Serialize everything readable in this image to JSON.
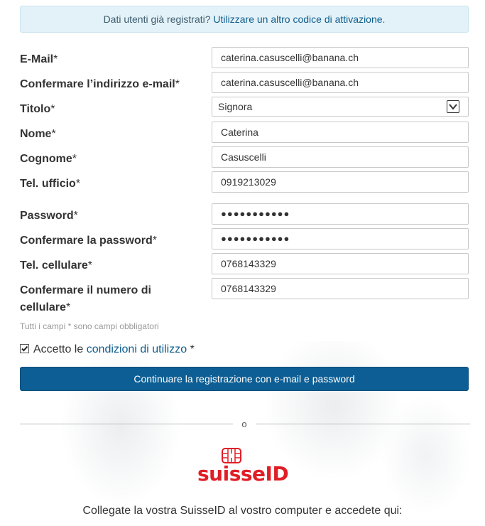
{
  "info": {
    "text": "Dati utenti già registrati?",
    "link": "Utilizzare un altro codice di attivazione",
    "suffix": "."
  },
  "form": {
    "email": {
      "label": "E-Mail",
      "value": "caterina.casuscelli@banana.ch"
    },
    "email_confirm": {
      "label": "Confermare l’indirizzo e-mail",
      "value": "caterina.casuscelli@banana.ch"
    },
    "title": {
      "label": "Titolo",
      "value": "Signora"
    },
    "first_name": {
      "label": "Nome",
      "value": "Caterina"
    },
    "last_name": {
      "label": "Cognome",
      "value": "Casuscelli"
    },
    "office_phone": {
      "label": "Tel. ufficio",
      "value": "0919213029"
    },
    "password": {
      "label": "Password",
      "value": "●●●●●●●●●●●"
    },
    "password_confirm": {
      "label": "Confermare la password",
      "value": "●●●●●●●●●●●"
    },
    "mobile": {
      "label": "Tel. cellulare",
      "value": "0768143329"
    },
    "mobile_confirm": {
      "label": "Confermare il numero di cellulare",
      "value": "0768143329"
    },
    "required_marker": "*",
    "required_note": "Tutti i campi * sono campi obbligatori",
    "terms_prefix": "Accetto le",
    "terms_link": "condizioni di utilizzo",
    "terms_suffix": " *",
    "terms_checked": true,
    "submit_label": "Continuare la registrazione con e-mail e password"
  },
  "alt": {
    "or_label": "o",
    "logo_text": "suisseID",
    "connect_text": "Collegate la vostra SuisseID al vostro computer e accedete qui:"
  },
  "colors": {
    "primary": "#0d5e94",
    "link": "#0e5c8c",
    "brand_red": "#e01e26",
    "info_bg": "#e3f2f8"
  }
}
